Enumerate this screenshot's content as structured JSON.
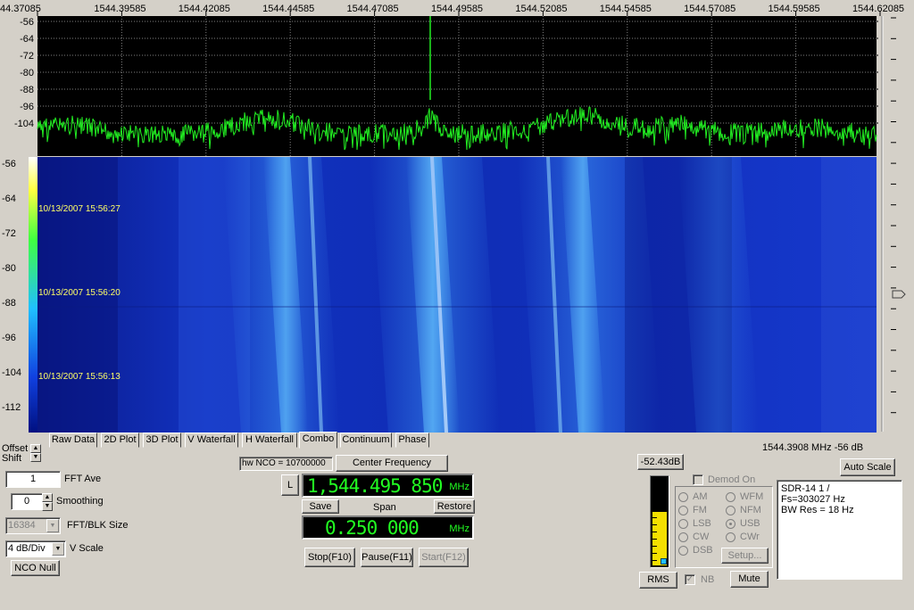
{
  "spectrum": {
    "freq_labels": [
      "44.37085",
      "1544.39585",
      "1544.42085",
      "1544.44585",
      "1544.47085",
      "1544.49585",
      "1544.52085",
      "1544.54585",
      "1544.57085",
      "1544.59585",
      "1544.62085"
    ],
    "db_labels": [
      "-56",
      "-64",
      "-72",
      "-80",
      "-88",
      "-96",
      "-104"
    ]
  },
  "waterfall": {
    "db_labels": [
      "-56",
      "-64",
      "-72",
      "-80",
      "-88",
      "-96",
      "-104",
      "-112"
    ],
    "timestamps": [
      "10/13/2007 15:56:27",
      "10/13/2007 15:56:20",
      "10/13/2007 15:56:13"
    ]
  },
  "tabs": [
    "Raw Data",
    "2D Plot",
    "3D Plot",
    "V Waterfall",
    "H Waterfall",
    "Combo",
    "Continuum",
    "Phase"
  ],
  "active_tab": "Combo",
  "controls": {
    "offset_label": "Offset",
    "shift_label": "Shift",
    "fft_ave_value": "1",
    "fft_ave_label": "FFT Ave",
    "smoothing_value": "0",
    "smoothing_label": "Smoothing",
    "fft_blk_value": "16384",
    "fft_blk_label": "FFT/BLK Size",
    "vscale_value": "4 dB/Div",
    "vscale_label": "V Scale",
    "nco_null_label": "NCO Null"
  },
  "tuning": {
    "hw_nco": "hw NCO = 10700000",
    "center_freq_button": "Center Frequency",
    "l_button": "L",
    "center_freq_value": "1,544.495 850",
    "center_unit": "MHz",
    "save_label": "Save",
    "span_label": "Span",
    "restore_label": "Restore",
    "span_value": "0.250 000",
    "span_unit": "MHz",
    "stop_label": "Stop(F10)",
    "pause_label": "Pause(F11)",
    "start_label": "Start(F12)"
  },
  "status": {
    "cursor_readout": "1544.3908 MHz  -56 dB",
    "auto_scale_label": "Auto Scale",
    "level_db": "-52.43dB",
    "level_fraction": 0.6,
    "rms_label": "RMS",
    "nb_label": "NB",
    "mute_label": "Mute"
  },
  "demod": {
    "demod_on_label": "Demod On",
    "modes_left": [
      "AM",
      "FM",
      "LSB",
      "CW",
      "DSB"
    ],
    "modes_right": [
      "WFM",
      "NFM",
      "USB",
      "CWr"
    ],
    "selected": "USB",
    "setup_label": "Setup..."
  },
  "info": {
    "lines": [
      "SDR-14 1  /",
      "Fs=303027 Hz",
      "BW Res =   18 Hz"
    ]
  },
  "colors": {
    "trace": "#22ee22",
    "grid": "#808080",
    "waterfall_bg": "#1230c8",
    "waterfall_line": "#7fe0ff",
    "timestamp": "#ffff66"
  }
}
